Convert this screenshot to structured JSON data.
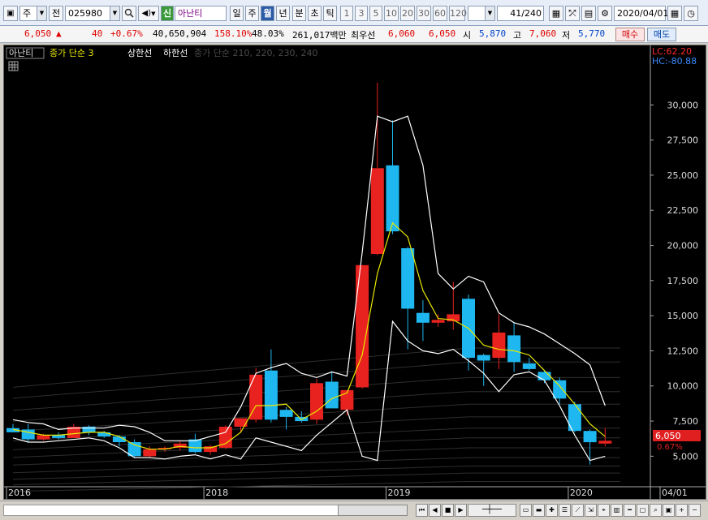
{
  "toolbar": {
    "market_label": "주",
    "all_label": "전",
    "code": "025980",
    "credit_badge": "신",
    "stock_name": "아난티",
    "periods": [
      "일",
      "주",
      "월",
      "년"
    ],
    "active_period": "월",
    "minute_labels": [
      "분",
      "초",
      "틱"
    ],
    "numbers": [
      "1",
      "3",
      "5",
      "10",
      "20",
      "30",
      "60",
      "120"
    ],
    "count": "41",
    "total": "/240",
    "date": "2020/04/01"
  },
  "info": {
    "price": "6,050",
    "change_arrow": "▲",
    "change": "40",
    "change_pct": "+0.67%",
    "volume": "40,650,904",
    "volume_ratio": "158.10%",
    "turnover": "48.03%",
    "amount": "261,017백만",
    "best_ask_label": "최우선",
    "best_ask": "6,060",
    "best_bid": "6,050",
    "open_label": "시",
    "open": "5,870",
    "high_label": "고",
    "high": "7,060",
    "low_label": "저",
    "low": "5,770",
    "buy_label": "매수",
    "sell_label": "매도"
  },
  "chart_legend": {
    "name": "아난티",
    "ma_label": "종가 단순 3",
    "upper_label": "상한선",
    "lower_label": "하한선",
    "ma_group": "종가 단순 210, 220, 230, 240"
  },
  "right_labels": {
    "lc": "LC:62.20",
    "hc": "HC:-80.88",
    "price_tag": "6,050",
    "pct_tag": "0.67%"
  },
  "chart_data": {
    "type": "candlestick",
    "y_ticks": [
      5000,
      7500,
      10000,
      12500,
      15000,
      17500,
      20000,
      22500,
      25000,
      27500,
      30000
    ],
    "y_tick_labels": [
      "5,000",
      "7,500",
      "10,000",
      "12,500",
      "15,000",
      "17,500",
      "20,000",
      "22,500",
      "25,000",
      "27,500",
      "30,000"
    ],
    "x_labels": [
      {
        "label": "2016",
        "index": 0
      },
      {
        "label": "2018",
        "index": 13
      },
      {
        "label": "2019",
        "index": 25
      },
      {
        "label": "2020",
        "index": 37
      },
      {
        "label": "04/01",
        "index": 43
      }
    ],
    "ylim": [
      3000,
      32500
    ],
    "candles": [
      {
        "o": 7000,
        "h": 7300,
        "l": 6700,
        "c": 6700
      },
      {
        "o": 6900,
        "h": 7300,
        "l": 6000,
        "c": 6200
      },
      {
        "o": 6200,
        "h": 6600,
        "l": 6100,
        "c": 6500
      },
      {
        "o": 6500,
        "h": 6700,
        "l": 6200,
        "c": 6300
      },
      {
        "o": 6300,
        "h": 7300,
        "l": 6300,
        "c": 7100
      },
      {
        "o": 7100,
        "h": 7200,
        "l": 6500,
        "c": 6700
      },
      {
        "o": 6700,
        "h": 6800,
        "l": 6300,
        "c": 6400
      },
      {
        "o": 6400,
        "h": 6500,
        "l": 5700,
        "c": 6000
      },
      {
        "o": 6000,
        "h": 6200,
        "l": 4900,
        "c": 5000
      },
      {
        "o": 5000,
        "h": 5700,
        "l": 4900,
        "c": 5500
      },
      {
        "o": 5500,
        "h": 5700,
        "l": 5300,
        "c": 5600
      },
      {
        "o": 5600,
        "h": 6100,
        "l": 5400,
        "c": 5900
      },
      {
        "o": 6200,
        "h": 6600,
        "l": 5200,
        "c": 5300
      },
      {
        "o": 5300,
        "h": 5800,
        "l": 5100,
        "c": 5700
      },
      {
        "o": 5600,
        "h": 7200,
        "l": 5500,
        "c": 7100
      },
      {
        "o": 7100,
        "h": 7700,
        "l": 6700,
        "c": 7700
      },
      {
        "o": 7600,
        "h": 11300,
        "l": 7400,
        "c": 10800
      },
      {
        "o": 11100,
        "h": 12600,
        "l": 7400,
        "c": 7600
      },
      {
        "o": 8300,
        "h": 8500,
        "l": 6900,
        "c": 7800
      },
      {
        "o": 7800,
        "h": 8200,
        "l": 7400,
        "c": 7500
      },
      {
        "o": 7600,
        "h": 10500,
        "l": 7300,
        "c": 10200
      },
      {
        "o": 10300,
        "h": 11000,
        "l": 8500,
        "c": 8400
      },
      {
        "o": 8300,
        "h": 9700,
        "l": 7900,
        "c": 9700
      },
      {
        "o": 9900,
        "h": 18500,
        "l": 9800,
        "c": 18600
      },
      {
        "o": 19400,
        "h": 31600,
        "l": 19300,
        "c": 25500
      },
      {
        "o": 25700,
        "h": 28900,
        "l": 20800,
        "c": 21000
      },
      {
        "o": 19800,
        "h": 19900,
        "l": 12600,
        "c": 15500
      },
      {
        "o": 15200,
        "h": 16100,
        "l": 13200,
        "c": 14500
      },
      {
        "o": 14500,
        "h": 15100,
        "l": 14200,
        "c": 14700
      },
      {
        "o": 14600,
        "h": 17400,
        "l": 14000,
        "c": 15100
      },
      {
        "o": 16200,
        "h": 16500,
        "l": 11100,
        "c": 12000
      },
      {
        "o": 12200,
        "h": 12300,
        "l": 10000,
        "c": 11800
      },
      {
        "o": 12000,
        "h": 15100,
        "l": 11200,
        "c": 13800
      },
      {
        "o": 13600,
        "h": 14500,
        "l": 11000,
        "c": 11700
      },
      {
        "o": 11600,
        "h": 12000,
        "l": 11100,
        "c": 11200
      },
      {
        "o": 11000,
        "h": 11100,
        "l": 10200,
        "c": 10400
      },
      {
        "o": 10400,
        "h": 10600,
        "l": 8700,
        "c": 9100
      },
      {
        "o": 8700,
        "h": 8900,
        "l": 6700,
        "c": 6800
      },
      {
        "o": 6800,
        "h": 6900,
        "l": 4400,
        "c": 6000
      },
      {
        "o": 5900,
        "h": 7000,
        "l": 5700,
        "c": 6100
      }
    ],
    "ma3": [
      6900,
      6700,
      6500,
      6500,
      6600,
      6700,
      6700,
      6400,
      5800,
      5500,
      5500,
      5700,
      5600,
      5600,
      5900,
      6700,
      8600,
      8600,
      8700,
      7600,
      8200,
      9100,
      9500,
      12200,
      18000,
      21600,
      20600,
      16800,
      14800,
      14700,
      14100,
      12900,
      12600,
      12500,
      12200,
      11100,
      10000,
      8700,
      7300,
      6400
    ],
    "upper": [
      7600,
      7400,
      7300,
      6900,
      7000,
      7000,
      7000,
      7200,
      7100,
      6700,
      6100,
      6100,
      6100,
      6400,
      6700,
      8500,
      10900,
      11300,
      11600,
      10900,
      10600,
      11000,
      10700,
      19500,
      29200,
      28800,
      29200,
      25700,
      18000,
      16900,
      17800,
      17400,
      15200,
      14500,
      14200,
      13700,
      13000,
      12300,
      11500,
      8600
    ],
    "lower": [
      6300,
      6000,
      6000,
      6100,
      6200,
      6300,
      6100,
      5600,
      4900,
      4900,
      4800,
      5000,
      5100,
      4800,
      5100,
      4800,
      6300,
      6000,
      5700,
      5400,
      6500,
      7400,
      8300,
      5000,
      4700,
      14600,
      13200,
      12500,
      12300,
      12600,
      11800,
      10900,
      9600,
      10800,
      11000,
      10400,
      8600,
      6500,
      4700,
      5000
    ]
  }
}
